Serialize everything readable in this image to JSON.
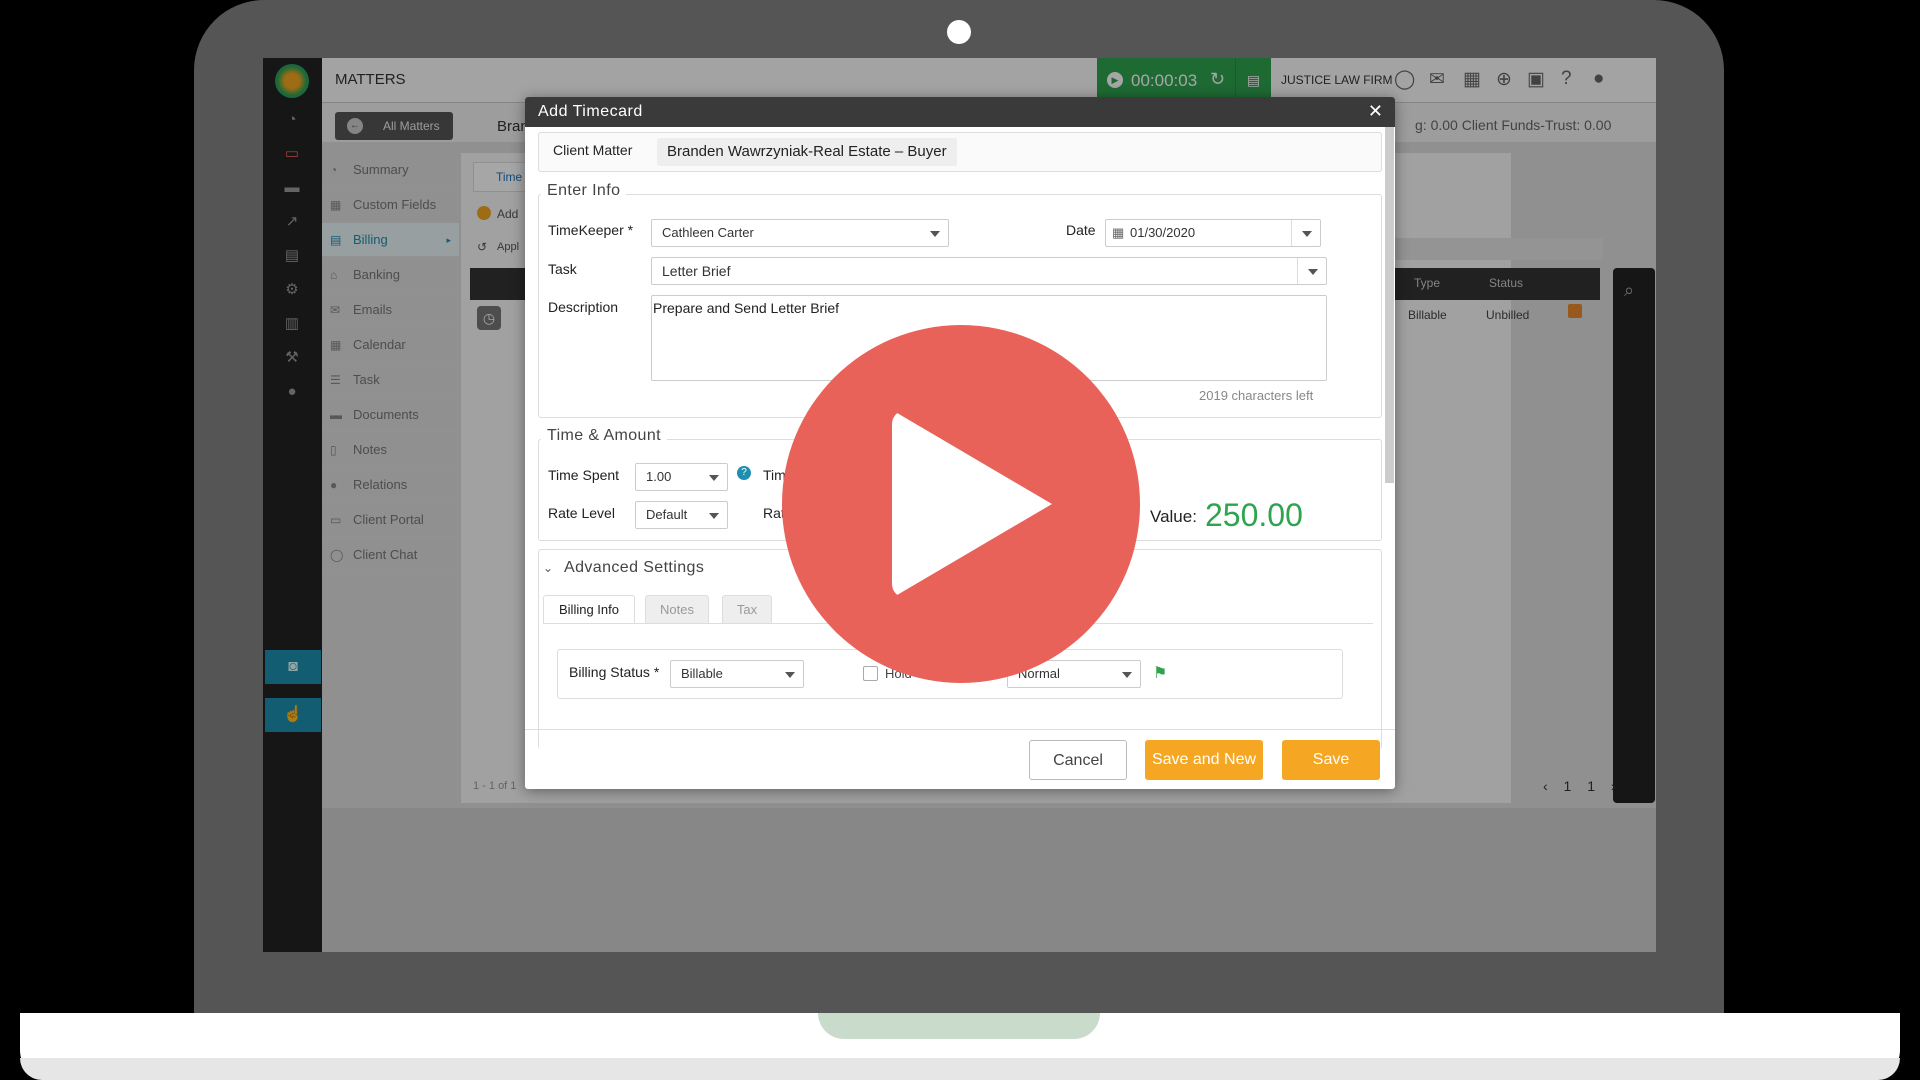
{
  "app": {
    "section_title": "MATTERS",
    "timer": "00:00:03",
    "firm_name": "JUSTICE LAW FIRM",
    "all_matters": "All Matters",
    "matter_title_fragment": "Bran",
    "funds": "g: 0.00   Client Funds-Trust: 0.00",
    "tab_time": "Time",
    "add_fragment": "Add",
    "apply_fragment": "Appl",
    "pager_left": "1 - 1 of 1",
    "pager": "‹ 1 1 ›",
    "side_menu": [
      "Summary",
      "Custom Fields",
      "Billing",
      "Banking",
      "Emails",
      "Calendar",
      "Task",
      "Documents",
      "Notes",
      "Relations",
      "Client Portal",
      "Client Chat"
    ],
    "grid": {
      "headers": [
        "Type",
        "Status"
      ],
      "row": [
        "Billable",
        "Unbilled"
      ]
    }
  },
  "modal": {
    "title": "Add Timecard",
    "client_matter_label": "Client Matter",
    "client_matter_value": "Branden Wawrzyniak-Real Estate – Buyer",
    "enter_info_legend": "Enter Info",
    "timekeeper_label": "TimeKeeper *",
    "timekeeper_value": "Cathleen Carter",
    "date_label": "Date",
    "date_value": "01/30/2020",
    "task_label": "Task",
    "task_value": "Letter Brief",
    "description_label": "Description",
    "description_value": "Prepare and Send Letter Brief",
    "chars_left": "2019 characters left",
    "time_amount_legend": "Time & Amount",
    "time_spent_label": "Time Spent",
    "time_spent_value": "1.00",
    "time_fragment": "Tim",
    "rate_level_label": "Rate Level",
    "rate_level_value": "Default",
    "rate_fragment": "Rat",
    "value_label": "Value:",
    "value_amount": "250.00",
    "advanced_legend": "Advanced Settings",
    "tabs": [
      "Billing Info",
      "Notes",
      "Tax"
    ],
    "billing_status_label": "Billing Status *",
    "billing_status_value": "Billable",
    "hold_label": "Hold",
    "priority_value": "Normal",
    "cancel": "Cancel",
    "save_and_new": "Save and New",
    "save": "Save"
  },
  "colors": {
    "accent_green": "#2ea44f",
    "button_orange": "#f5a623",
    "play_red": "#e8625a",
    "sidebar_blue": "#1e8fb1"
  }
}
